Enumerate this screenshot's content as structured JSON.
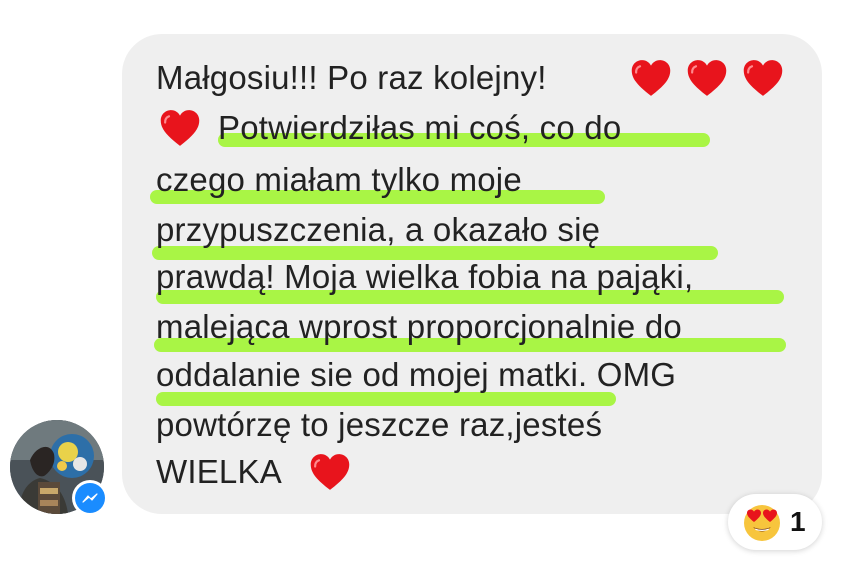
{
  "message": {
    "lines": [
      "Małgosiu!!! Po raz kolejny!",
      "Potwierdziłas mi coś, co do",
      "czego miałam tylko moje",
      "przypuszczenia, a okazało się",
      "prawdą! Moja wielka fobia na pająki,",
      "malejąca wprost proporcjonalnie do",
      "oddalanie sie od mojej matki. OMG",
      "powtórzę to jeszcze raz,jesteś",
      "WIELKA"
    ]
  },
  "icons": {
    "heart": "red-heart-icon",
    "messenger": "messenger-icon",
    "reaction": "heart-eyes-emoji-icon"
  },
  "reaction": {
    "count": "1"
  },
  "colors": {
    "bubble": "#efefef",
    "highlight": "#a9f545",
    "heart": "#e8141c",
    "messenger": "#1a8cff",
    "text": "#222222"
  }
}
